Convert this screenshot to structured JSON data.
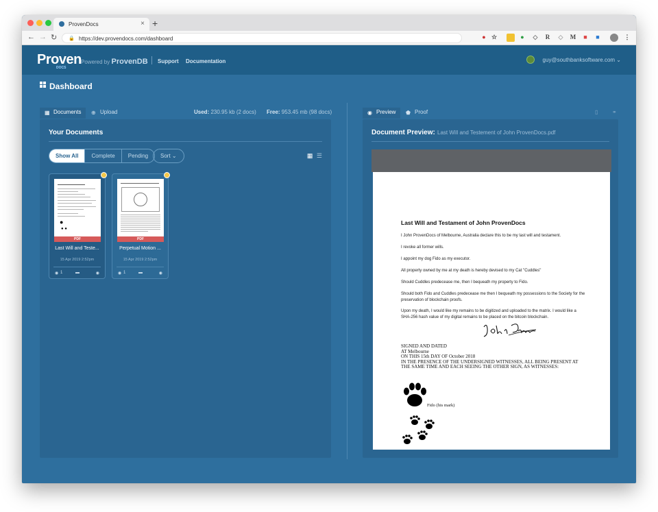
{
  "browser": {
    "tab_title": "ProvenDocs",
    "new_tab": "+",
    "url": "https://dev.provendocs.com/dashboard"
  },
  "header": {
    "logo": "Proven",
    "logo_sub": "DOCS",
    "powered_by": "Powered by",
    "powered_by_brand": "ProvenDB",
    "nav": [
      "Support",
      "Documentation"
    ],
    "user_email": "guy@southbanksoftware.com"
  },
  "dashboard": {
    "title": "Dashboard"
  },
  "left_panel": {
    "tabs": [
      {
        "label": "Documents",
        "icon": "grid-icon"
      },
      {
        "label": "Upload",
        "icon": "upload-icon"
      }
    ],
    "used_label": "Used:",
    "used_value": "230.95 kb (2 docs)",
    "free_label": "Free:",
    "free_value": "953.45 mb (98 docs)",
    "heading": "Your Documents",
    "filters": [
      "Show All",
      "Complete",
      "Pending"
    ],
    "sort_label": "Sort",
    "documents": [
      {
        "name": "Last Will and Teste...",
        "date": "15 Apr 2019 2:52pm",
        "type": "PDF",
        "proofs": "1",
        "selected": true
      },
      {
        "name": "Perpetual Motion ...",
        "date": "15 Apr 2019 2:52pm",
        "type": "PDF",
        "proofs": "1",
        "selected": false
      }
    ]
  },
  "right_panel": {
    "tabs": [
      {
        "label": "Preview",
        "icon": "eye-icon"
      },
      {
        "label": "Proof",
        "icon": "shield-icon"
      }
    ],
    "heading": "Document Preview:",
    "filename": "Last Will and Testement of John ProvenDocs.pdf",
    "document": {
      "title": "Last Will and Testament of John ProvenDocs",
      "paragraphs": [
        "I John ProvenDocs of Melbourne, Australia declare this to be my last will and testament.",
        "I revoke all former wills.",
        "I appoint my dog Fido as my executor.",
        "All property owned by me at my death is hereby devised to my Cat \"Cuddles\"",
        "Should Cuddles predecease me, then I bequeath my property to Fido.",
        "Should both Fido and Cuddles predecease me then I bequeath my possessions to the Society for the preservation of blockchain proofs.",
        "Upon my death, I would like my remains to be digitized and uploaded to the matrix.  I would like a SHA-256 hash value of my digital remains to be placed on the bitcoin blockchain."
      ],
      "signed_lines": [
        "SIGNED AND DATED",
        "AT Melbourne",
        "ON THIS  15th DAY OF October 2018",
        "IN THE PRESENCE OF THE UNDERSIGNED WITNESSES, ALL BEING PRESENT AT",
        "THE SAME TIME AND EACH SEEING THE OTHER SIGN, AS WITNESSES:"
      ],
      "witness_mark": "Fido  (his mark)"
    }
  },
  "colors": {
    "app_bg": "#2e6f9e",
    "header_bg": "#1f5e88",
    "panel_bg": "#2a6591",
    "pdf_badge": "#d65a5a"
  }
}
